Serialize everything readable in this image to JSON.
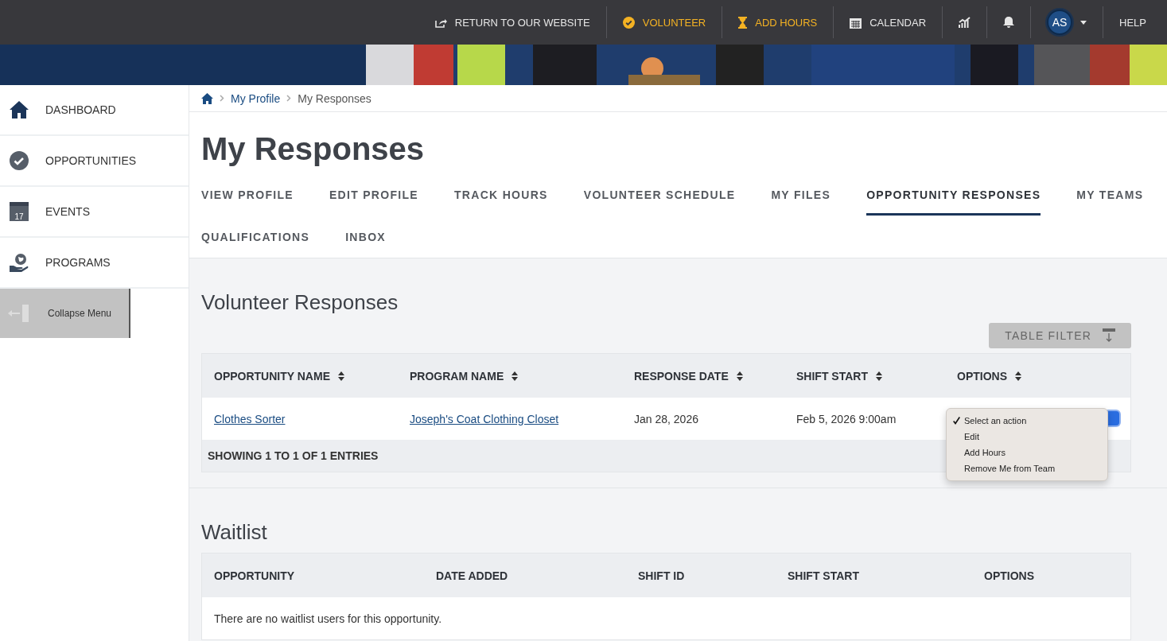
{
  "top_nav": [
    {
      "kind": "share",
      "label": "RETURN TO OUR WEBSITE",
      "highlight": false
    },
    {
      "kind": "check",
      "label": "VOLUNTEER",
      "highlight": true
    },
    {
      "kind": "hourglass",
      "label": "ADD HOURS",
      "highlight": true
    },
    {
      "kind": "calendar",
      "label": "CALENDAR",
      "highlight": false
    },
    {
      "kind": "chart"
    },
    {
      "kind": "bell"
    },
    {
      "kind": "avatar",
      "label": "AS"
    },
    {
      "kind": "text",
      "label": "HELP",
      "highlight": false
    }
  ],
  "sidebar": {
    "items": [
      {
        "kind": "home",
        "label": "DASHBOARD"
      },
      {
        "kind": "check",
        "label": "OPPORTUNITIES"
      },
      {
        "kind": "calendar",
        "label": "EVENTS",
        "icon_text": "17"
      },
      {
        "kind": "globe",
        "label": "PROGRAMS"
      }
    ],
    "collapse": "Collapse Menu"
  },
  "breadcrumb": [
    {
      "label": "My Profile",
      "link": true
    },
    {
      "label": "My Responses",
      "link": false
    }
  ],
  "title": "My Responses",
  "tabs": [
    {
      "label": "VIEW PROFILE",
      "selected": false
    },
    {
      "label": "EDIT PROFILE",
      "selected": false
    },
    {
      "label": "TRACK HOURS",
      "selected": false
    },
    {
      "label": "VOLUNTEER SCHEDULE",
      "selected": false
    },
    {
      "label": "MY FILES",
      "selected": false
    },
    {
      "label": "OPPORTUNITY RESPONSES",
      "selected": true
    },
    {
      "label": "MY TEAMS",
      "selected": false
    },
    {
      "label": "QUALIFICATIONS",
      "selected": false
    },
    {
      "label": "INBOX",
      "selected": false
    }
  ],
  "responses": {
    "title": "Volunteer Responses",
    "filter_button": "TABLE FILTER",
    "columns": [
      "OPPORTUNITY NAME",
      "PROGRAM NAME",
      "RESPONSE DATE",
      "SHIFT START",
      "OPTIONS"
    ],
    "rows": [
      {
        "opportunity": "Clothes Sorter",
        "program": "Joseph's Coat Clothing Closet",
        "response_date": "Jan 28, 2026",
        "shift_start": "Feb 5, 2026 9:00am",
        "options_menu": [
          {
            "label": "Select an action",
            "selected": true
          },
          {
            "label": "Edit",
            "selected": false
          },
          {
            "label": "Add Hours",
            "selected": false
          },
          {
            "label": "Remove Me from Team",
            "selected": false
          }
        ]
      }
    ],
    "footer": "SHOWING 1 TO 1 OF 1 ENTRIES"
  },
  "waitlist": {
    "title": "Waitlist",
    "columns": [
      "OPPORTUNITY",
      "DATE ADDED",
      "SHIFT ID",
      "SHIFT START",
      "OPTIONS"
    ],
    "empty": "There are no waitlist users for this opportunity."
  }
}
